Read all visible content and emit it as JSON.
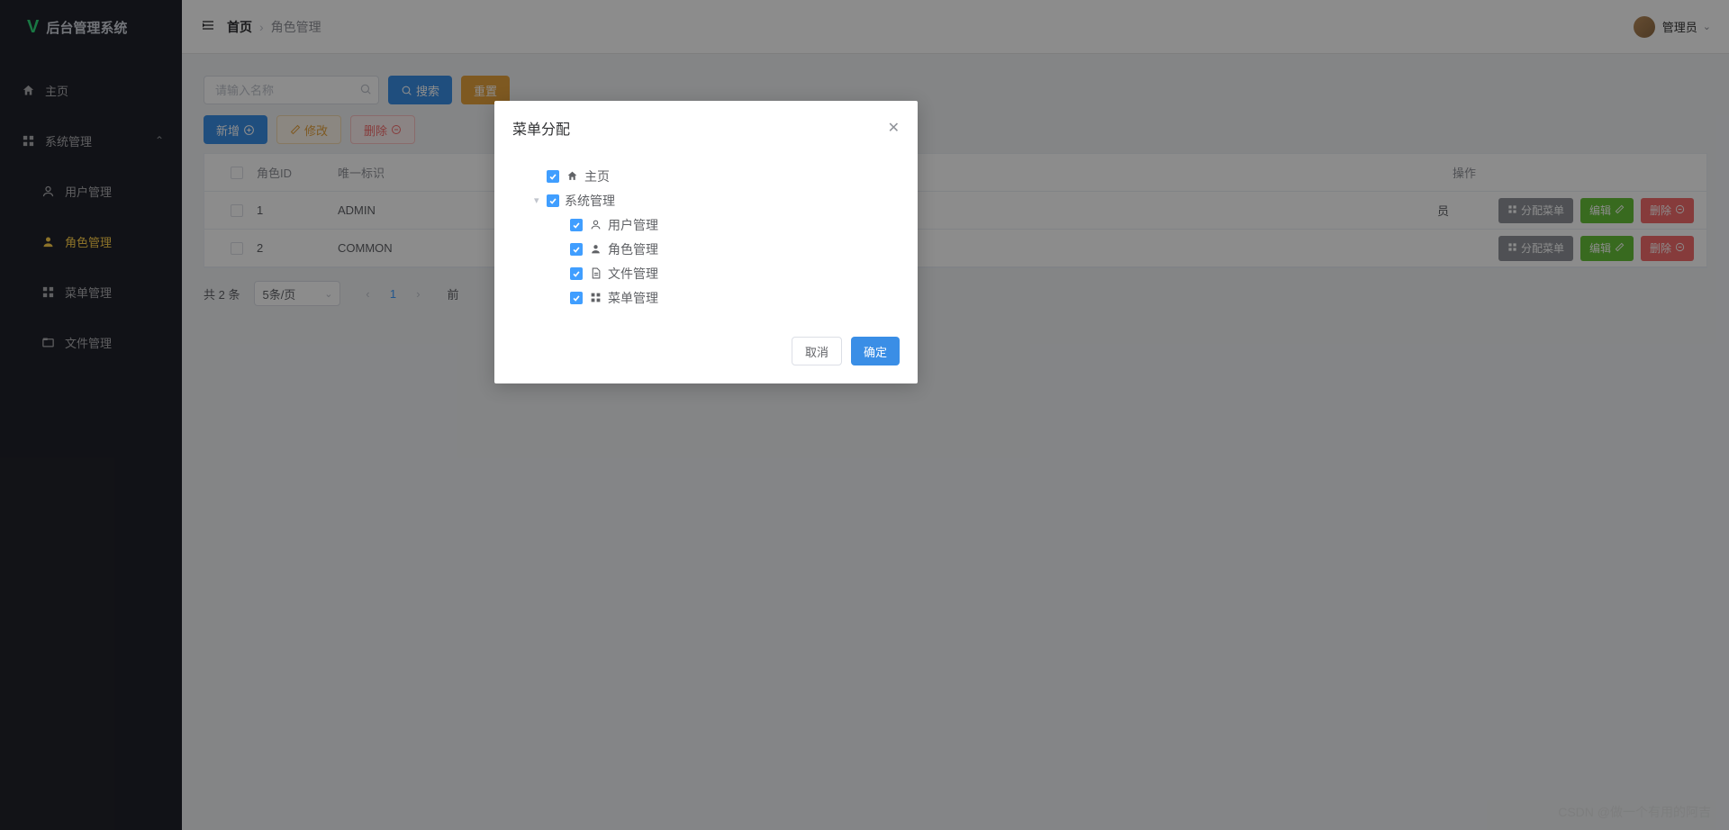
{
  "app": {
    "name": "后台管理系统"
  },
  "user": {
    "name": "管理员"
  },
  "sidebar": {
    "items": [
      {
        "label": "主页"
      },
      {
        "label": "系统管理"
      },
      {
        "label": "用户管理"
      },
      {
        "label": "角色管理"
      },
      {
        "label": "菜单管理"
      },
      {
        "label": "文件管理"
      }
    ]
  },
  "breadcrumb": {
    "home": "首页",
    "current": "角色管理"
  },
  "search": {
    "placeholder": "请输入名称",
    "search_btn": "搜索",
    "reset_btn": "重置"
  },
  "toolbar": {
    "add": "新增",
    "edit": "修改",
    "delete": "删除"
  },
  "table": {
    "headers": {
      "id": "角色ID",
      "unique": "唯一标识",
      "ops": "操作"
    },
    "rows": [
      {
        "id": "1",
        "unique": "ADMIN",
        "extra": "员"
      },
      {
        "id": "2",
        "unique": "COMMON",
        "extra": ""
      }
    ],
    "ops": {
      "assign": "分配菜单",
      "edit": "编辑",
      "delete": "删除"
    }
  },
  "pagination": {
    "total_label": "共 2 条",
    "page_size": "5条/页",
    "current": "1",
    "goto_label_prefix": "前"
  },
  "modal": {
    "title": "菜单分配",
    "tree": [
      {
        "label": "主页",
        "icon": "home"
      },
      {
        "label": "系统管理",
        "icon": "grid",
        "expandable": true,
        "children": [
          {
            "label": "用户管理",
            "icon": "user-o"
          },
          {
            "label": "角色管理",
            "icon": "user-s"
          },
          {
            "label": "文件管理",
            "icon": "file"
          },
          {
            "label": "菜单管理",
            "icon": "grid4"
          }
        ]
      }
    ],
    "cancel": "取消",
    "confirm": "确定"
  },
  "watermark": "CSDN @做一个有用的阿吉"
}
